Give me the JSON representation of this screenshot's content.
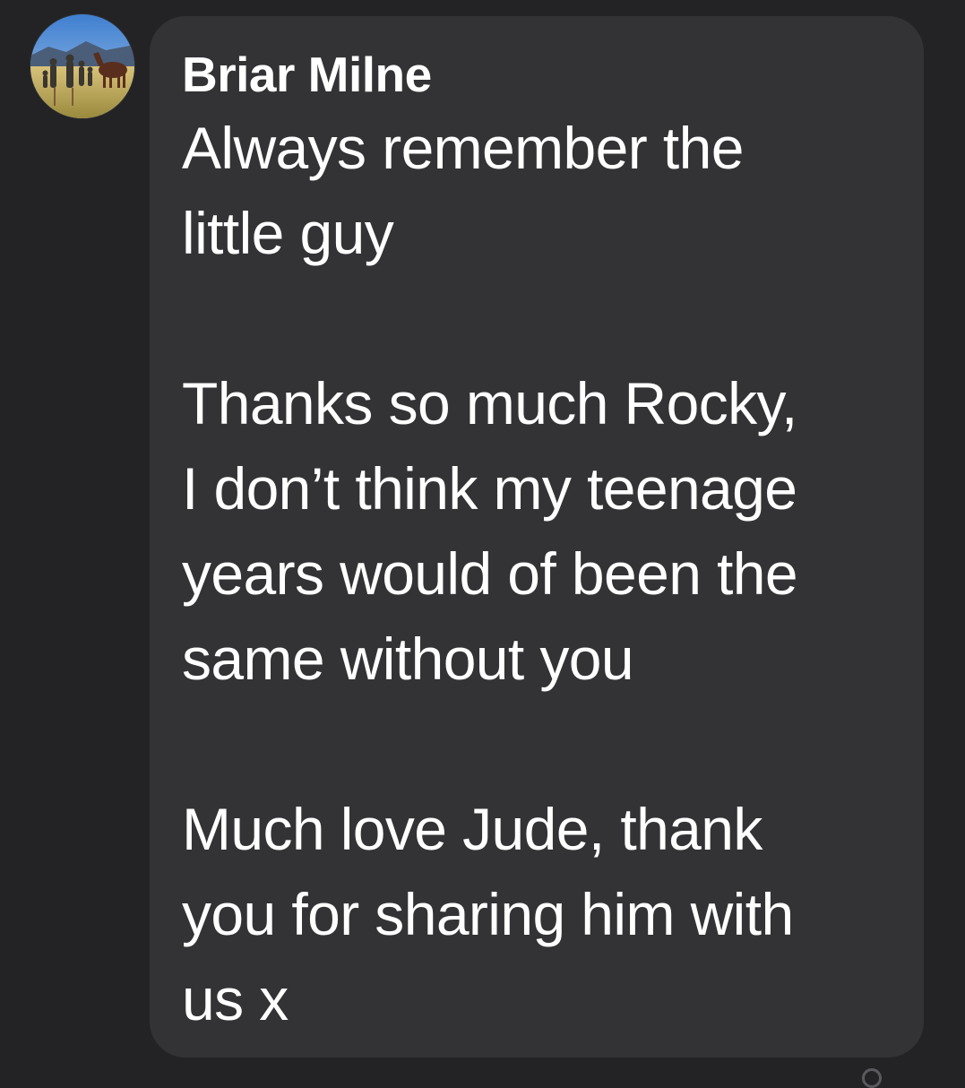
{
  "comment": {
    "author": "Briar Milne",
    "paragraphs": [
      "Always remember the\nlittle guy",
      "Thanks so much Rocky,\nI don’t think my teenage\nyears would of been the\nsame without you",
      "Much love Jude, thank\nyou for sharing him with\nus x"
    ]
  },
  "colors": {
    "background": "#232325",
    "bubble": "#333336",
    "text": "#ffffff"
  },
  "icons": {
    "avatar": "profile-photo-avatar"
  }
}
